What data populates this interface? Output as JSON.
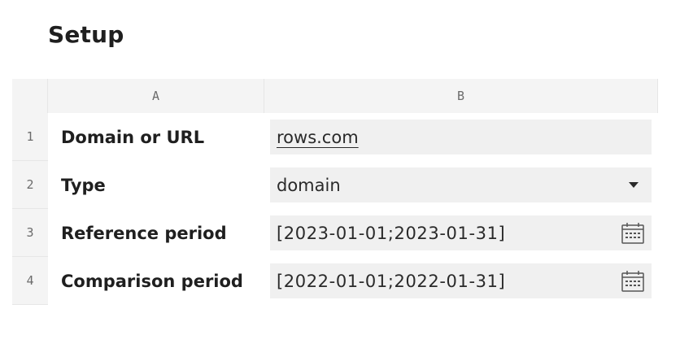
{
  "page": {
    "title": "Setup"
  },
  "grid": {
    "columns": [
      "A",
      "B"
    ],
    "rows": [
      {
        "number": "1",
        "label": "Domain or URL",
        "value": "rows.com",
        "kind": "link"
      },
      {
        "number": "2",
        "label": "Type",
        "value": "domain",
        "kind": "dropdown"
      },
      {
        "number": "3",
        "label": "Reference period",
        "value": "[2023-01-01;2023-01-31]",
        "kind": "date-range"
      },
      {
        "number": "4",
        "label": "Comparison period",
        "value": "[2022-01-01;2022-01-31]",
        "kind": "date-range"
      }
    ]
  },
  "icons": {
    "dropdown": "chevron-down-icon",
    "date": "calendar-icon"
  },
  "colors": {
    "header_bg": "#f4f4f4",
    "input_bg": "#f0f0f0",
    "muted_text": "#6b6b6b"
  }
}
